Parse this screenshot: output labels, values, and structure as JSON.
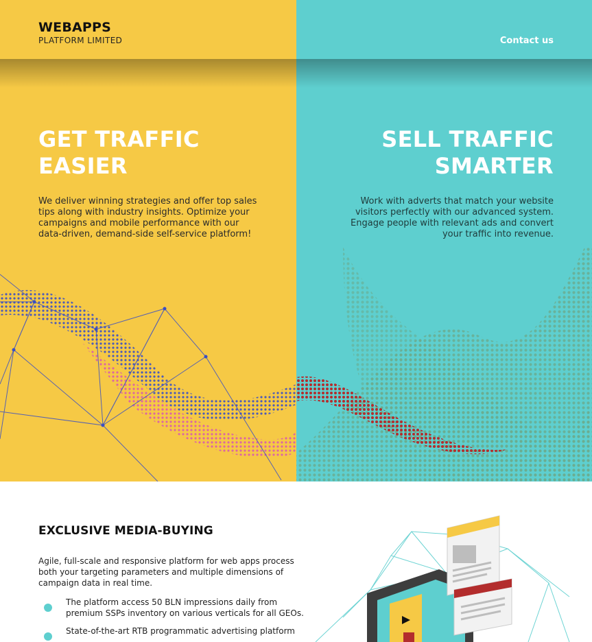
{
  "header": {
    "logo_main": "WEBAPPS",
    "logo_sub": "PLATFORM LIMITED",
    "contact_label": "Contact us"
  },
  "hero": {
    "left": {
      "headline_line1": "GET TRAFFIC",
      "headline_line2": "EASIER",
      "text": "We deliver winning strategies and offer top sales tips along with industry insights. Optimize your campaigns and mobile performance with our data-driven, demand-side self-service platform!",
      "bg_color": "#f6c945"
    },
    "right": {
      "headline_line1": "SELL TRAFFIC",
      "headline_line2": "SMARTER",
      "text": "Work with adverts that match your website visitors perfectly with our advanced system. Engage people with relevant ads and convert your traffic into revenue.",
      "bg_color": "#5ecfcf"
    }
  },
  "section": {
    "title": "EXCLUSIVE MEDIA-BUYING",
    "text": "Agile, full-scale and responsive platform for web apps process both your targeting parameters and multiple dimensions of campaign data in real time.",
    "bullets": [
      "The platform access 50 BLN impressions daily from premium SSPs inventory on various verticals for all GEOs.",
      "State-of-the-art RTB programmatic advertising platform"
    ],
    "bullet_color": "#5ecfcf",
    "illustration_icon": "media-buying-illustration"
  }
}
